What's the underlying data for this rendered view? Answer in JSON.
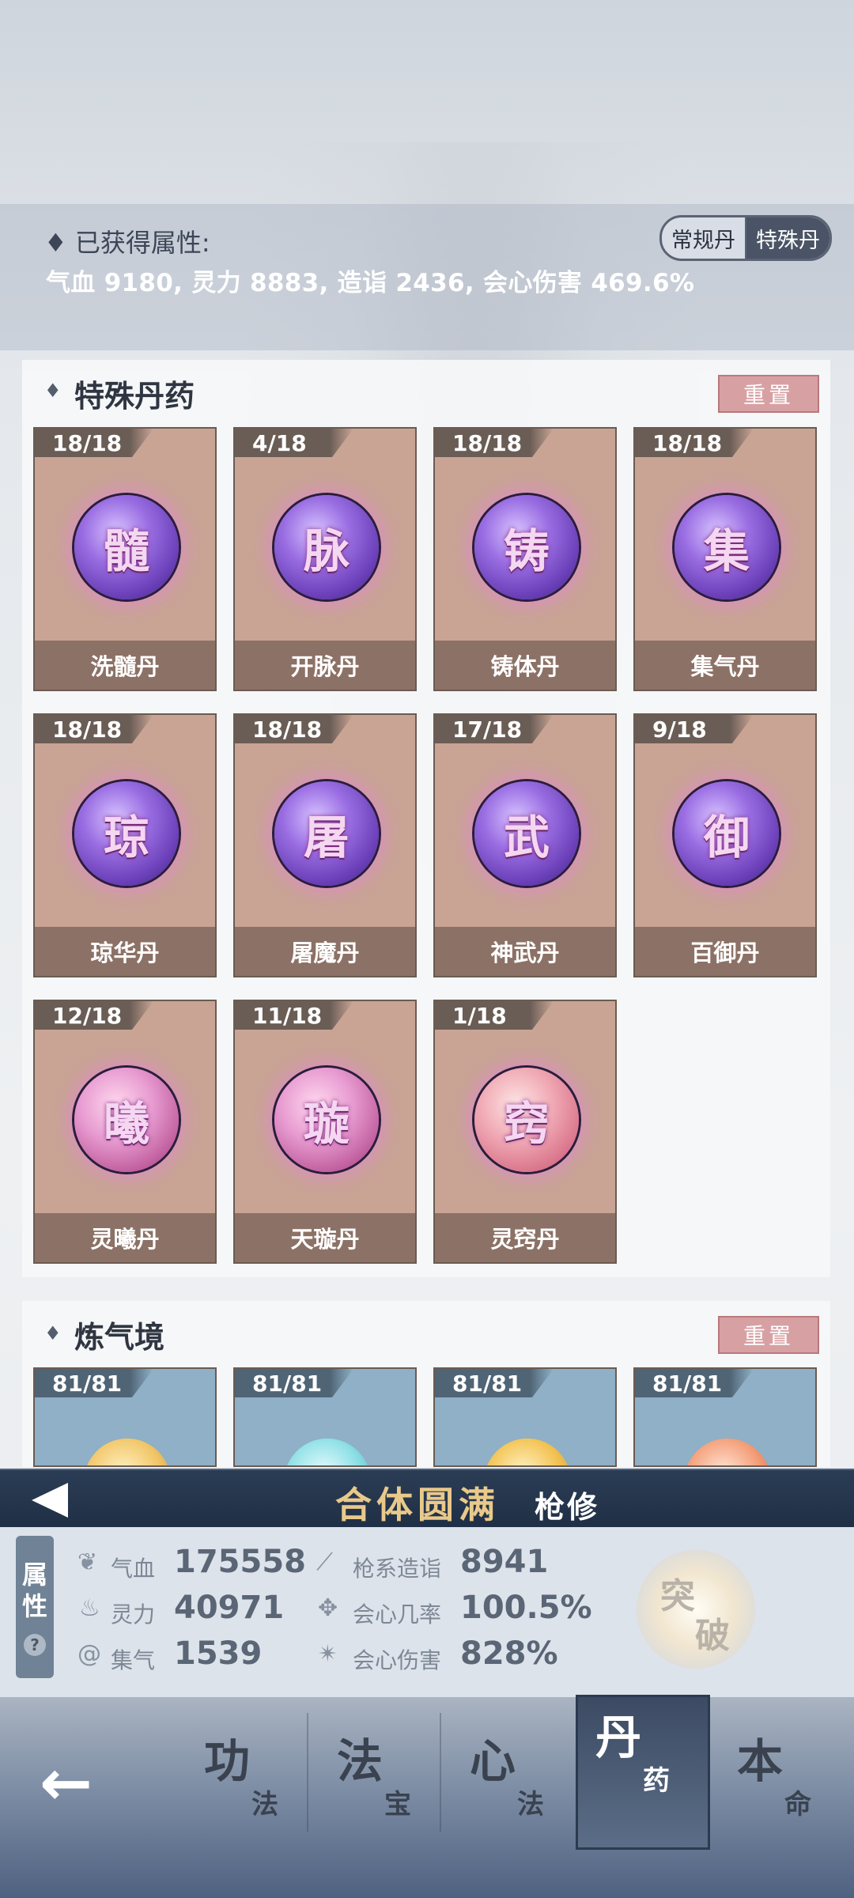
{
  "summary": {
    "title": "已获得属性:",
    "text": "气血 9180, 灵力 8883, 造诣 2436, 会心伤害 469.6%",
    "tabs": [
      {
        "label": "常规丹",
        "active": false
      },
      {
        "label": "特殊丹",
        "active": true
      }
    ]
  },
  "special": {
    "title": "特殊丹药",
    "reset_label": "重置",
    "pills": [
      {
        "count": "18/18",
        "glyph": "髓",
        "name": "洗髓丹"
      },
      {
        "count": "4/18",
        "glyph": "脉",
        "name": "开脉丹"
      },
      {
        "count": "18/18",
        "glyph": "铸",
        "name": "铸体丹"
      },
      {
        "count": "18/18",
        "glyph": "集",
        "name": "集气丹"
      },
      {
        "count": "18/18",
        "glyph": "琼",
        "name": "琼华丹"
      },
      {
        "count": "18/18",
        "glyph": "屠",
        "name": "屠魔丹"
      },
      {
        "count": "17/18",
        "glyph": "武",
        "name": "神武丹"
      },
      {
        "count": "9/18",
        "glyph": "御",
        "name": "百御丹"
      },
      {
        "count": "12/18",
        "glyph": "曦",
        "name": "灵曦丹"
      },
      {
        "count": "11/18",
        "glyph": "璇",
        "name": "天璇丹"
      },
      {
        "count": "1/18",
        "glyph": "窍",
        "name": "灵窍丹"
      }
    ]
  },
  "realm_section": {
    "title": "炼气境",
    "reset_label": "重置",
    "counts": [
      "81/81",
      "81/81",
      "81/81",
      "81/81"
    ]
  },
  "banner": {
    "realm": "合体圆满",
    "school": "枪修"
  },
  "stats": {
    "tab_top": "属",
    "tab_bottom": "性",
    "help": "?",
    "left": [
      {
        "icon": "heart-icon",
        "label": "气血",
        "value": "175558"
      },
      {
        "icon": "flame-icon",
        "label": "灵力",
        "value": "40971"
      },
      {
        "icon": "swirl-icon",
        "label": "集气",
        "value": "1539"
      }
    ],
    "right": [
      {
        "icon": "spear-icon",
        "label": "枪系造诣",
        "value": "8941"
      },
      {
        "icon": "crit-rate-icon",
        "label": "会心几率",
        "value": "100.5%"
      },
      {
        "icon": "crit-damage-icon",
        "label": "会心伤害",
        "value": "828%"
      }
    ],
    "breakthrough": [
      "突",
      "破"
    ]
  },
  "nav": {
    "back": "←",
    "items": [
      {
        "main": "功",
        "sub": "法",
        "active": false
      },
      {
        "main": "法",
        "sub": "宝",
        "active": false
      },
      {
        "main": "心",
        "sub": "法",
        "active": false
      },
      {
        "main": "丹",
        "sub": "药",
        "active": true
      },
      {
        "main": "本",
        "sub": "命",
        "active": false
      }
    ]
  }
}
